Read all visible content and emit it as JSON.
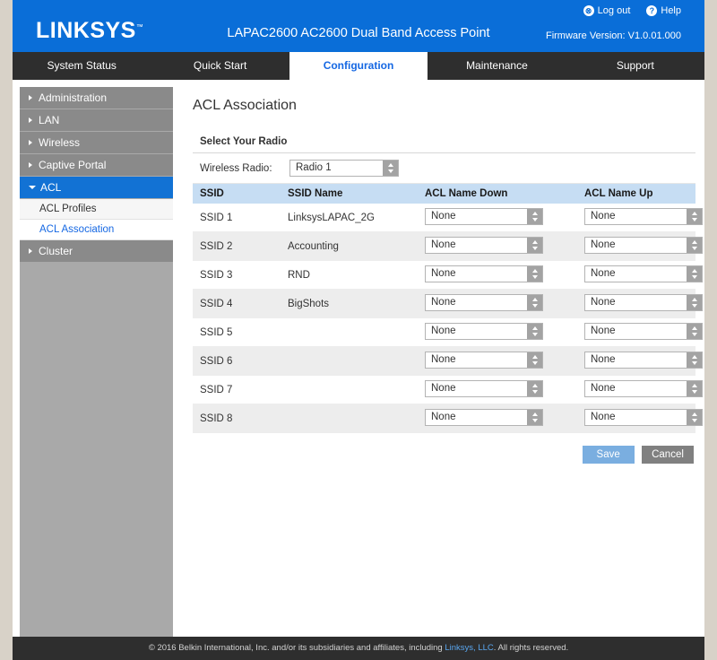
{
  "header": {
    "logo": "LINKSYS",
    "product_title": "LAPAC2600 AC2600 Dual Band Access Point",
    "firmware": "Firmware Version: V1.0.01.000",
    "logout_label": "Log out",
    "logout_icon": "lock-icon",
    "help_label": "Help",
    "help_icon": "question-icon",
    "brand_color": "#0a6ed8"
  },
  "nav": {
    "items": [
      {
        "label": "System Status",
        "active": false
      },
      {
        "label": "Quick Start",
        "active": false
      },
      {
        "label": "Configuration",
        "active": true
      },
      {
        "label": "Maintenance",
        "active": false
      },
      {
        "label": "Support",
        "active": false
      }
    ],
    "active_color": "#1668e3"
  },
  "sidebar": {
    "items": [
      {
        "label": "Administration",
        "selected": false,
        "expanded": false
      },
      {
        "label": "LAN",
        "selected": false,
        "expanded": false
      },
      {
        "label": "Wireless",
        "selected": false,
        "expanded": false
      },
      {
        "label": "Captive Portal",
        "selected": false,
        "expanded": false
      },
      {
        "label": "ACL",
        "selected": true,
        "expanded": true
      },
      {
        "label": "Cluster",
        "selected": false,
        "expanded": false
      }
    ],
    "sub_items": [
      {
        "label": "ACL Profiles",
        "selected": false
      },
      {
        "label": "ACL Association",
        "selected": true
      }
    ]
  },
  "main": {
    "page_title": "ACL Association",
    "panel_title": "Select Your Radio",
    "radio_label": "Wireless Radio:",
    "radio_value": "Radio 1",
    "columns": [
      "SSID",
      "SSID Name",
      "ACL Name Down",
      "ACL Name Up"
    ],
    "rows": [
      {
        "ssid": "SSID 1",
        "name": "LinksysLAPAC_2G",
        "down": "None",
        "up": "None"
      },
      {
        "ssid": "SSID 2",
        "name": "Accounting",
        "down": "None",
        "up": "None"
      },
      {
        "ssid": "SSID 3",
        "name": "RND",
        "down": "None",
        "up": "None"
      },
      {
        "ssid": "SSID 4",
        "name": "BigShots",
        "down": "None",
        "up": "None"
      },
      {
        "ssid": "SSID 5",
        "name": "",
        "down": "None",
        "up": "None"
      },
      {
        "ssid": "SSID 6",
        "name": "",
        "down": "None",
        "up": "None"
      },
      {
        "ssid": "SSID 7",
        "name": "",
        "down": "None",
        "up": "None"
      },
      {
        "ssid": "SSID 8",
        "name": "",
        "down": "None",
        "up": "None"
      }
    ],
    "save_label": "Save",
    "cancel_label": "Cancel"
  },
  "footer": {
    "text_before": "© 2016 Belkin International, Inc. and/or its subsidiaries and affiliates, including ",
    "link": "Linksys, LLC",
    "text_after": ". All rights reserved."
  }
}
